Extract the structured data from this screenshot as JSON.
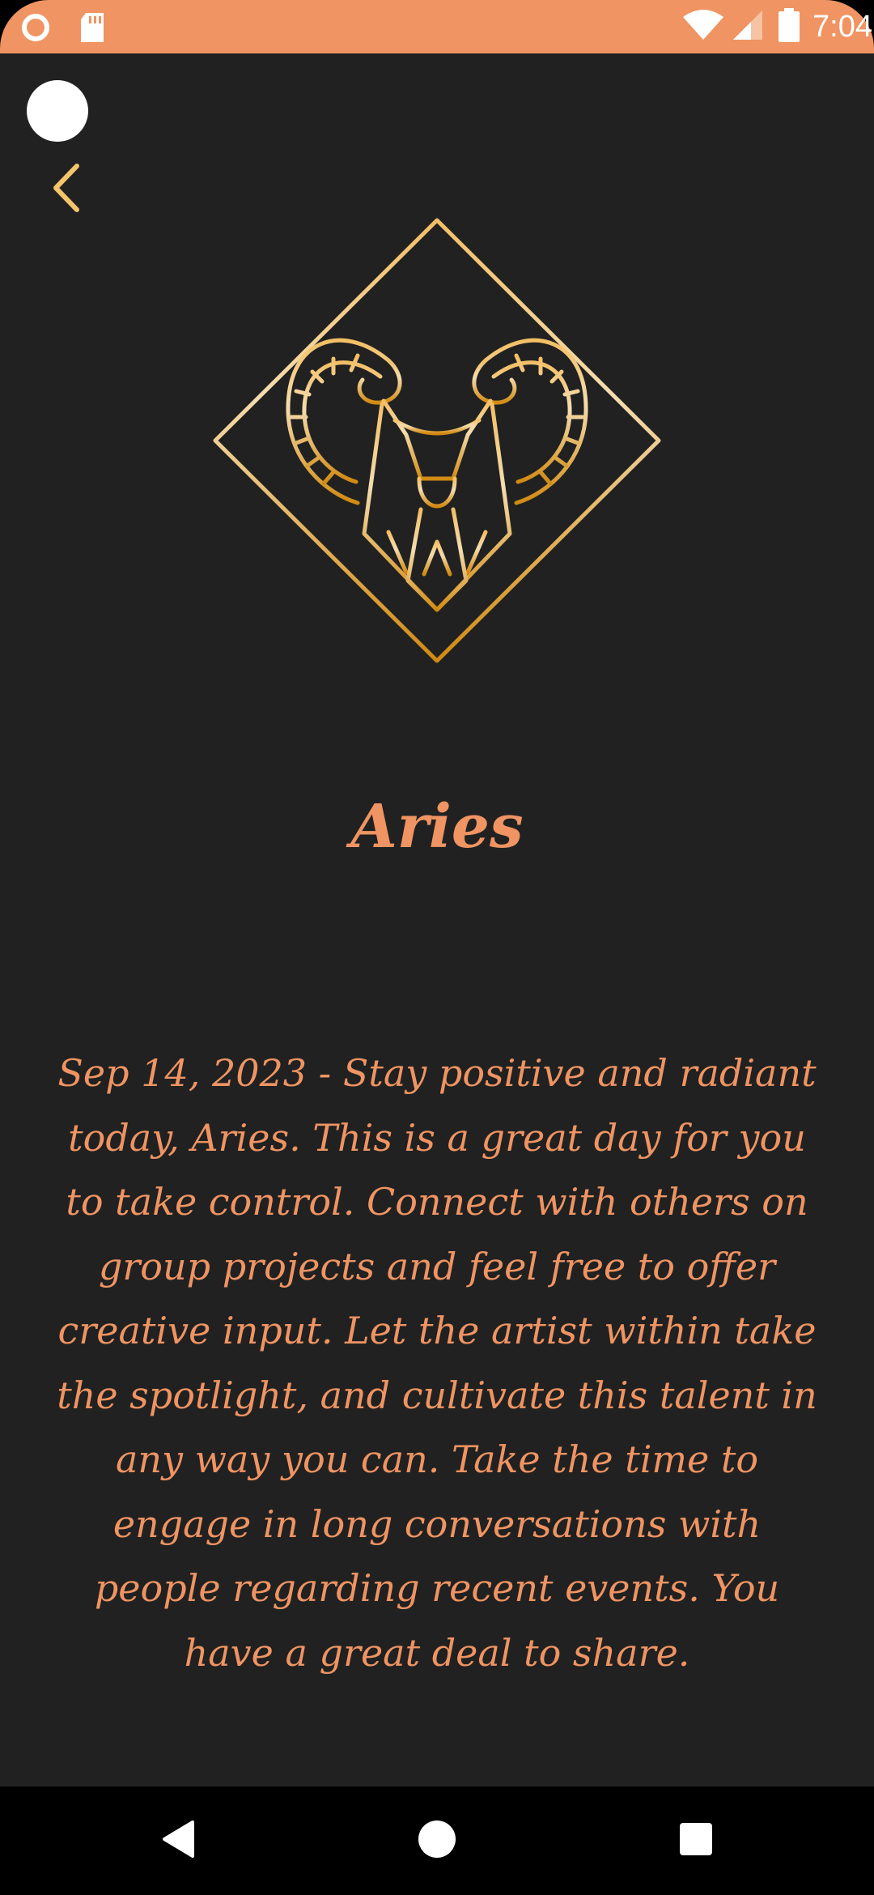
{
  "status_bar": {
    "time": "7:04",
    "icons": [
      "notification-icon",
      "sd-card-icon",
      "wifi-icon",
      "cellular-signal-icon",
      "battery-icon"
    ],
    "background": "#ef9462"
  },
  "header": {
    "back_icon": "chevron-left-icon",
    "accent": "#f3c46a"
  },
  "sign": {
    "emblem_icon": "aries-ram-icon",
    "name": "Aries"
  },
  "horoscope": {
    "text": "Sep 14, 2023 - Stay positive and radiant today, Aries. This is a great day for you to take control. Connect with others on group projects and feel free to offer creative input. Let the artist within take the spotlight, and cultivate this talent in any way you can. Take the time to engage in long conversations with people regarding recent events. You have a great deal to share."
  },
  "nav_bar": {
    "icons": [
      "back-triangle-icon",
      "home-circle-icon",
      "recents-square-icon"
    ]
  },
  "colors": {
    "background": "#212121",
    "text_accent": "#ef9462",
    "gold_light": "#f5d9a0",
    "gold_dark": "#d48a10"
  }
}
